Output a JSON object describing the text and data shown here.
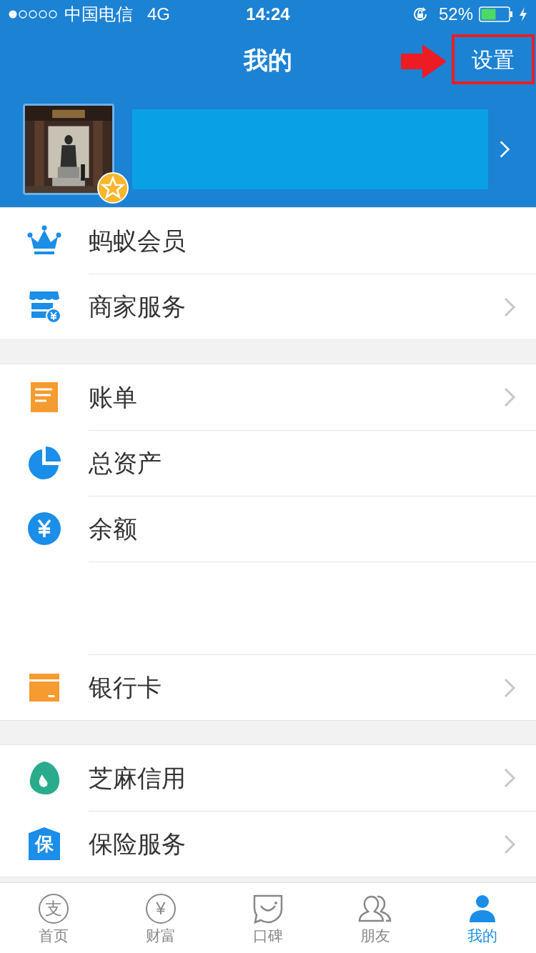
{
  "status_bar": {
    "carrier": "中国电信",
    "network": "4G",
    "time": "14:24",
    "battery": "52%"
  },
  "header": {
    "title": "我的",
    "action": "设置"
  },
  "sections": [
    {
      "items": [
        {
          "kind": "crown",
          "label": "蚂蚁会员",
          "chevron": false
        },
        {
          "kind": "shop",
          "label": "商家服务",
          "chevron": true
        }
      ]
    },
    {
      "items": [
        {
          "kind": "bill",
          "label": "账单",
          "chevron": true
        },
        {
          "kind": "pie",
          "label": "总资产",
          "chevron": false
        },
        {
          "kind": "yuan",
          "label": "余额",
          "chevron": false
        },
        {
          "kind": "blank"
        },
        {
          "kind": "card",
          "label": "银行卡",
          "chevron": true
        }
      ]
    },
    {
      "items": [
        {
          "kind": "drop",
          "label": "芝麻信用",
          "chevron": true
        },
        {
          "kind": "shield",
          "label": "保险服务",
          "chevron": true,
          "badge": "保"
        }
      ]
    }
  ],
  "tab_bar": [
    {
      "kind": "home",
      "label": "首页",
      "selected": false,
      "glyph": "支"
    },
    {
      "kind": "wealth",
      "label": "财富",
      "selected": false,
      "glyph": "¥"
    },
    {
      "kind": "koubei",
      "label": "口碑",
      "selected": false
    },
    {
      "kind": "friends",
      "label": "朋友",
      "selected": false
    },
    {
      "kind": "me",
      "label": "我的",
      "selected": true
    }
  ]
}
